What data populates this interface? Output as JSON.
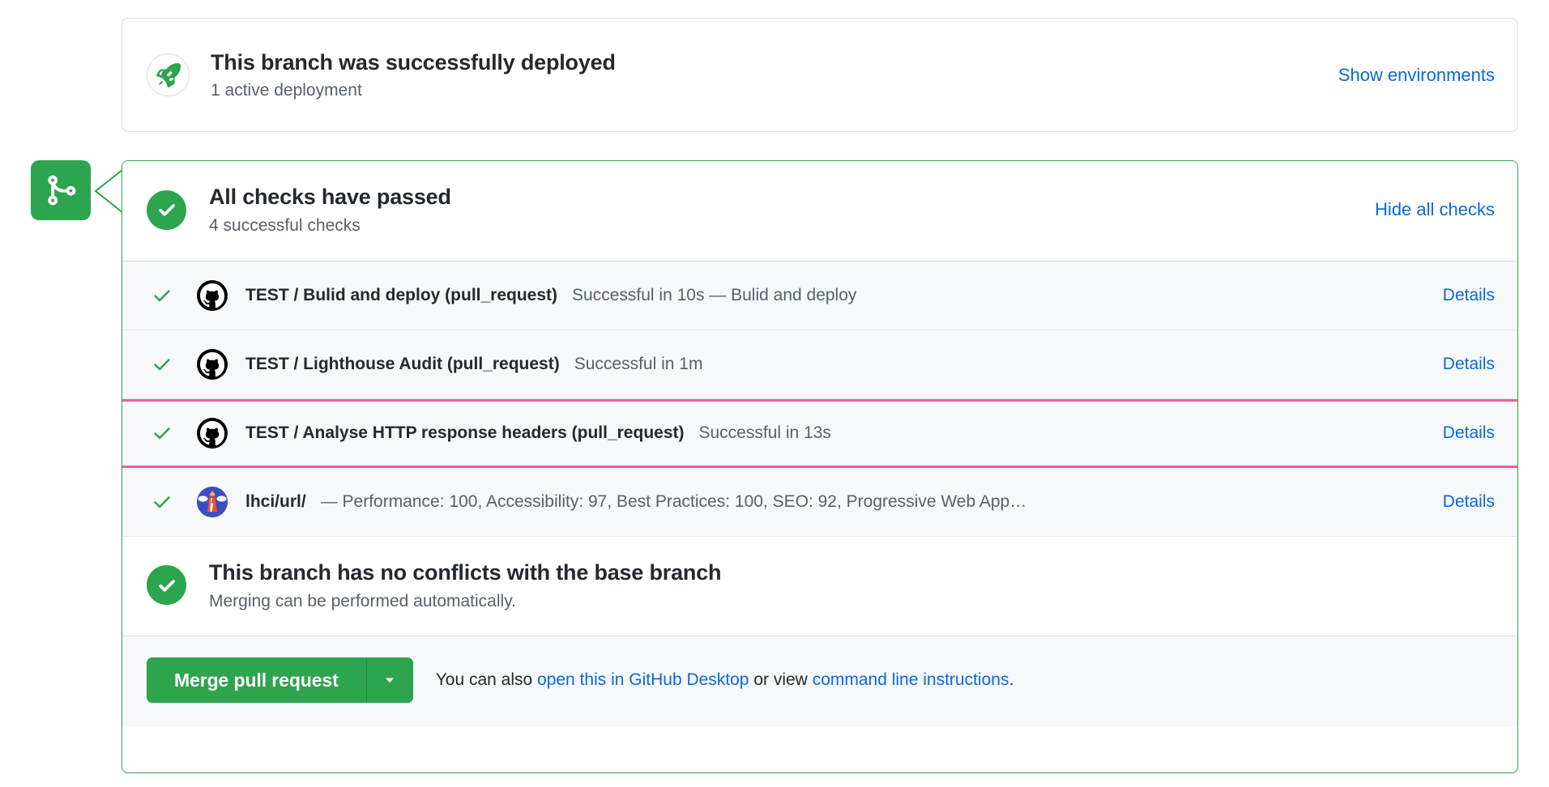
{
  "deployment": {
    "icon": "rocket-icon",
    "title": "This branch was successfully deployed",
    "subtitle": "1 active deployment",
    "action_label": "Show environments"
  },
  "branch_badge": {
    "icon": "git-merge-icon",
    "color": "#2da44e"
  },
  "checks": {
    "icon": "check-circle-icon",
    "title": "All checks have passed",
    "subtitle": "4 successful checks",
    "toggle_label": "Hide all checks",
    "rows": [
      {
        "status_icon": "check-icon",
        "avatar": "github-actions-icon",
        "name": "TEST / Bulid and deploy (pull_request)",
        "description": "Successful in 10s — Bulid and deploy",
        "details_label": "Details",
        "highlighted": false
      },
      {
        "status_icon": "check-icon",
        "avatar": "github-actions-icon",
        "name": "TEST / Lighthouse Audit (pull_request)",
        "description": "Successful in 1m",
        "details_label": "Details",
        "highlighted": false
      },
      {
        "status_icon": "check-icon",
        "avatar": "github-actions-icon",
        "name": "TEST / Analyse HTTP response headers (pull_request)",
        "description": "Successful in 13s",
        "details_label": "Details",
        "highlighted": true
      },
      {
        "status_icon": "check-icon",
        "avatar": "lighthouse-ci-icon",
        "name": "lhci/url/",
        "description": "— Performance: 100, Accessibility: 97, Best Practices: 100, SEO: 92, Progressive Web App…",
        "details_label": "Details",
        "highlighted": false
      }
    ]
  },
  "conflicts": {
    "icon": "check-circle-icon",
    "title": "This branch has no conflicts with the base branch",
    "subtitle": "Merging can be performed automatically."
  },
  "merge": {
    "button_label": "Merge pull request",
    "caret_icon": "chevron-down-icon",
    "note_prefix": "You can also ",
    "link_desktop": "open this in GitHub Desktop",
    "note_middle": " or view ",
    "link_cli": "command line instructions",
    "note_suffix": "."
  },
  "colors": {
    "green": "#2da44e",
    "link_blue": "#0969da",
    "highlight_pink": "#ef5f9d",
    "row_bg": "#f6f8fa",
    "text_primary": "#24292f",
    "text_muted": "#57606a",
    "border": "#d8dee4"
  }
}
